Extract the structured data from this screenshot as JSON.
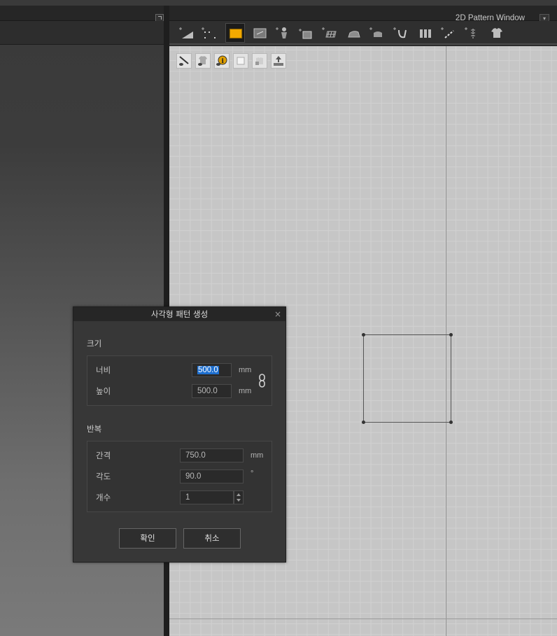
{
  "window": {
    "title": "2D Pattern Window",
    "menu_glyph": "▾"
  },
  "toolbar": {
    "tools": [
      {
        "name": "edit-pattern-tool-icon",
        "active": false
      },
      {
        "name": "edit-point-tool-icon",
        "active": false
      },
      {
        "name": "rectangle-tool-icon",
        "active": true
      },
      {
        "name": "internal-shape-tool-icon",
        "active": false
      },
      {
        "name": "pin-tool-icon",
        "active": false
      },
      {
        "name": "transform-pattern-icon",
        "active": false
      },
      {
        "name": "texture-grid-icon",
        "active": false
      },
      {
        "name": "iron-tool-icon",
        "active": false
      },
      {
        "name": "sewing-tool-icon",
        "active": false
      },
      {
        "name": "segment-sewing-icon",
        "active": false
      },
      {
        "name": "pleats-tool-icon",
        "active": false
      },
      {
        "name": "tape-tool-icon",
        "active": false
      },
      {
        "name": "zipper-tool-icon",
        "active": false
      },
      {
        "name": "garment-tool-icon",
        "active": false
      }
    ]
  },
  "canvas_tools": [
    {
      "name": "show-edit-icon"
    },
    {
      "name": "show-garment-icon"
    },
    {
      "name": "info-icon"
    },
    {
      "name": "trim-icon"
    },
    {
      "name": "lock-icon"
    },
    {
      "name": "upload-icon"
    }
  ],
  "dialog": {
    "title": "사각형 패턴 생성",
    "close_glyph": "×",
    "size_section": {
      "label": "크기",
      "width_label": "너비",
      "width_value": "500.0",
      "width_unit": "mm",
      "height_label": "높이",
      "height_value": "500.0",
      "height_unit": "mm"
    },
    "repeat_section": {
      "label": "반복",
      "spacing_label": "간격",
      "spacing_value": "750.0",
      "spacing_unit": "mm",
      "angle_label": "각도",
      "angle_value": "90.0",
      "angle_unit": "°",
      "count_label": "개수",
      "count_value": "1"
    },
    "ok_label": "확인",
    "cancel_label": "취소"
  },
  "colors": {
    "selection": "#1e6fcf",
    "active_tool": "#f2a900"
  }
}
